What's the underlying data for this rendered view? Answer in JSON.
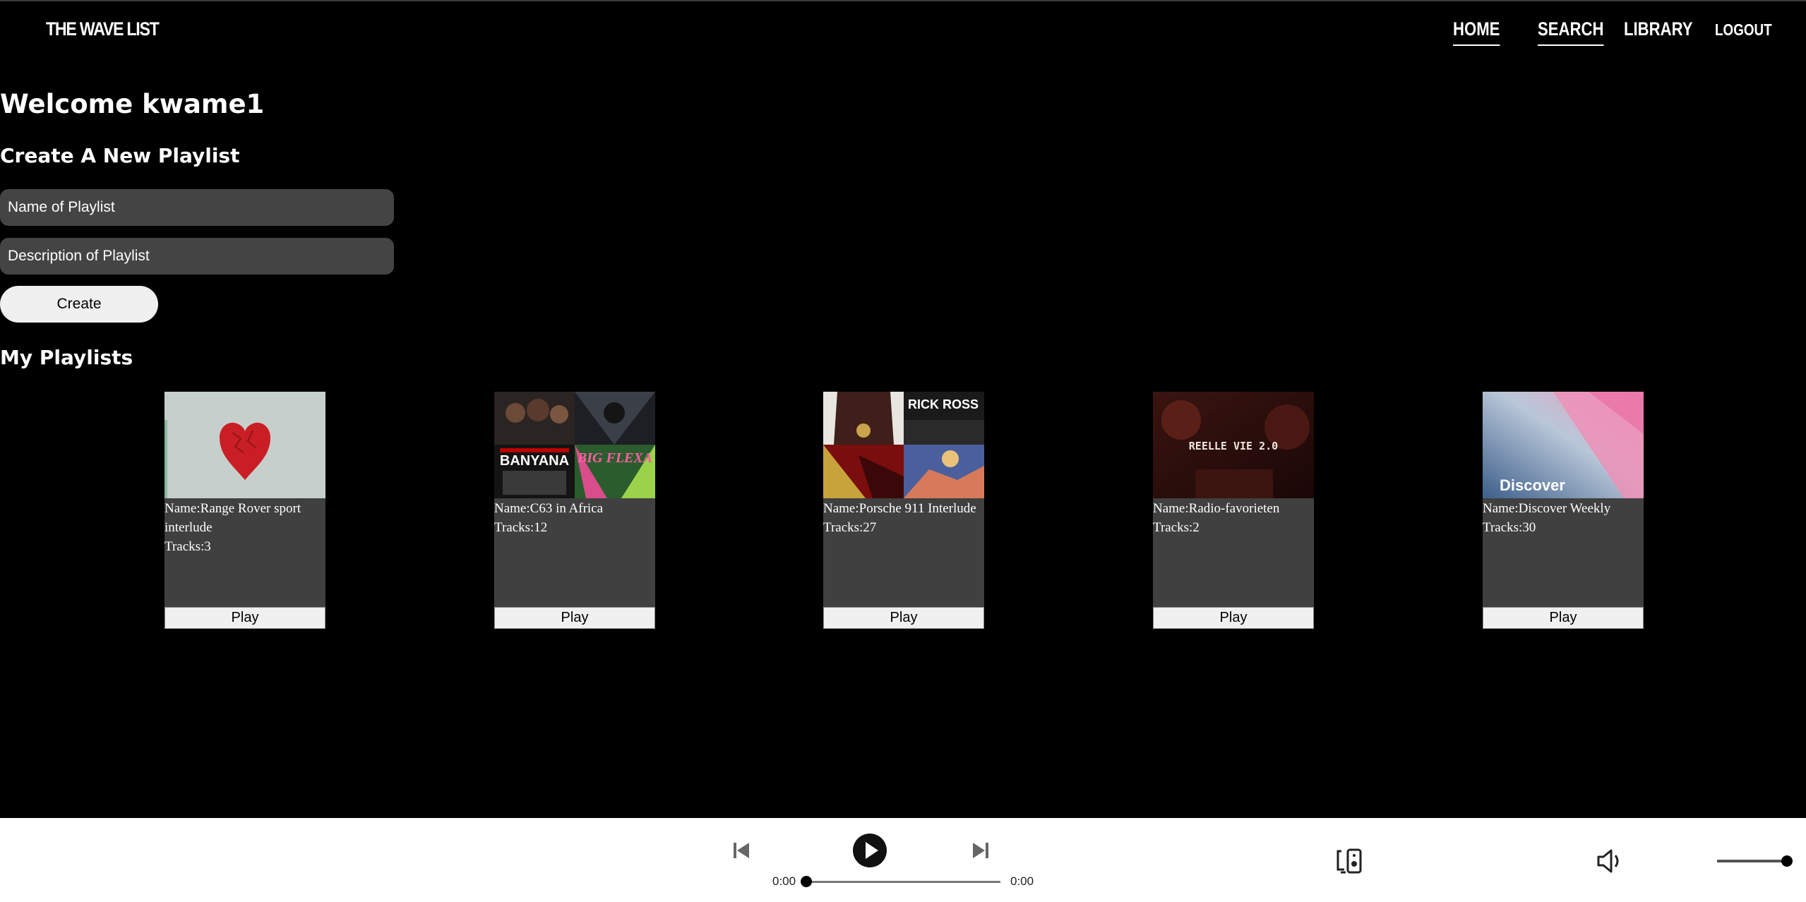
{
  "app": {
    "brand": "THE WAVE LIST"
  },
  "nav": {
    "items": [
      {
        "label": "HOME"
      },
      {
        "label": "SEARCH"
      },
      {
        "label": "LIBRARY"
      },
      {
        "label": "LOGOUT"
      }
    ]
  },
  "welcome": "Welcome kwame1",
  "create": {
    "title": "Create A New Playlist",
    "name_placeholder": "Name of Playlist",
    "name_value": "",
    "description_placeholder": "Description of Playlist",
    "description_value": "",
    "button_label": "Create"
  },
  "playlists": {
    "title": "My Playlists",
    "items": [
      {
        "name": "Name:Range Rover sport interlude",
        "tracks": "Tracks:3",
        "play_label": "Play"
      },
      {
        "name": "Name:C63 in Africa",
        "tracks": "Tracks:12",
        "play_label": "Play"
      },
      {
        "name": "Name:Porsche 911 Interlude",
        "tracks": "Tracks:27",
        "play_label": "Play"
      },
      {
        "name": "Name:Radio-favorieten",
        "tracks": "Tracks:2",
        "play_label": "Play"
      },
      {
        "name": "Name:Discover Weekly",
        "tracks": "Tracks:30",
        "play_label": "Play"
      }
    ]
  },
  "cover_text": {
    "banyana": "BANYANA",
    "big_flexa": "BIG FLEXA",
    "rick_ross": "RICK ROSS",
    "radio": "REELLE VIE 2.0",
    "discover": "Discover"
  },
  "player": {
    "current_time": "0:00",
    "duration": "0:00",
    "progress": 0,
    "volume": 1
  }
}
